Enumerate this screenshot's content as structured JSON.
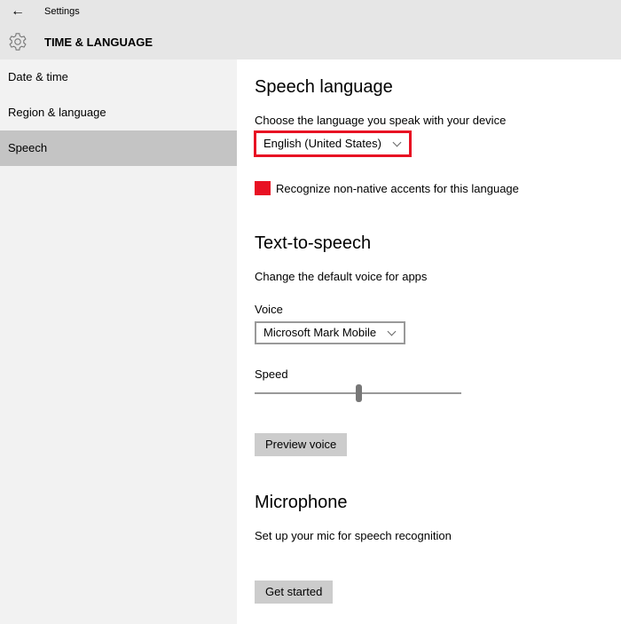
{
  "titlebar": {
    "back_icon": "arrow-left-icon",
    "app_title": "Settings",
    "section_icon": "gear-icon",
    "section_title": "TIME & LANGUAGE"
  },
  "sidebar": {
    "items": [
      {
        "label": "Date & time",
        "selected": false
      },
      {
        "label": "Region & language",
        "selected": false
      },
      {
        "label": "Speech",
        "selected": true
      }
    ]
  },
  "speech_language": {
    "heading": "Speech language",
    "description": "Choose the language you speak with your device",
    "selected_language": "English (United States)",
    "checkbox_label": "Recognize non-native accents for this language",
    "checkbox_checked": true
  },
  "tts": {
    "heading": "Text-to-speech",
    "description": "Change the default voice for apps",
    "voice_label": "Voice",
    "voice_value": "Microsoft Mark Mobile",
    "speed_label": "Speed",
    "speed_percent": 50,
    "preview_button": "Preview voice"
  },
  "microphone": {
    "heading": "Microphone",
    "description": "Set up your mic for speech recognition",
    "button": "Get started"
  },
  "colors": {
    "accent": "#e81123",
    "header_bg": "#e6e6e6",
    "sidebar_bg": "#f2f2f2",
    "selected_bg": "#c4c4c4"
  }
}
